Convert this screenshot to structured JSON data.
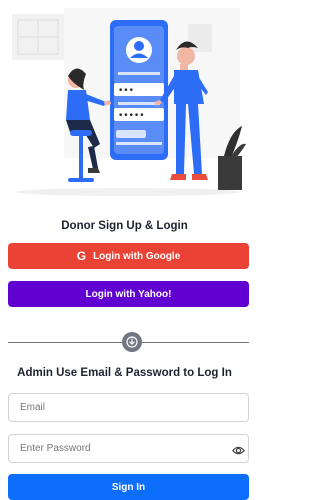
{
  "donor": {
    "title": "Donor Sign Up & Login",
    "google_label": "Login with Google",
    "google_icon": "G",
    "yahoo_label": "Login with Yahoo!"
  },
  "admin": {
    "title": "Admin Use Email & Password to Log In",
    "email_placeholder": "Email",
    "password_placeholder": "Enter Password",
    "signin_label": "Sign In"
  },
  "illustration": {
    "password_dots": "•••",
    "confirm_dots": "•••••"
  },
  "colors": {
    "google": "#ea4335",
    "yahoo": "#6001d2",
    "primary": "#0d6efd",
    "divider": "#737373"
  },
  "icons": [
    "login-illustration",
    "google-icon",
    "chevron-down-icon",
    "eye-icon"
  ]
}
